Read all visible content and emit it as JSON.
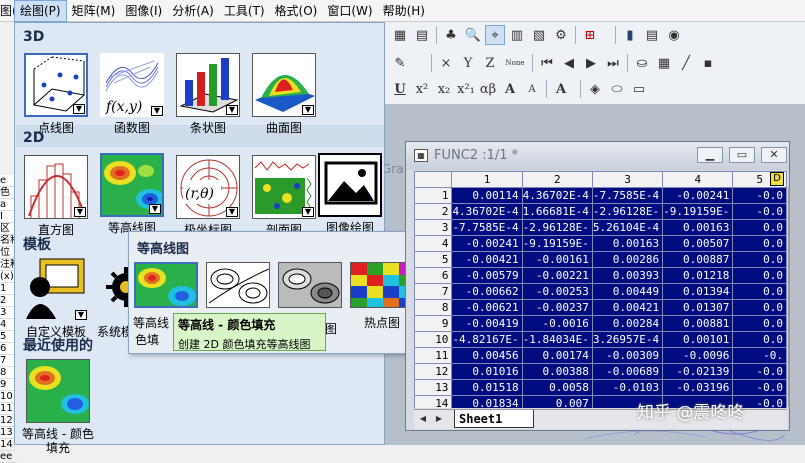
{
  "menubar": {
    "items": [
      "图(A)",
      "绘图(P)",
      "矩阵(M)",
      "图像(I)",
      "分析(A)",
      "工具(T)",
      "格式(O)",
      "窗口(W)",
      "帮助(H)"
    ]
  },
  "dropdown": {
    "section_3d": "3D",
    "section_2d": "2D",
    "section_templates": "模板",
    "section_recent": "最近使用的",
    "tiles_3d": [
      "点线图",
      "函数图",
      "条状图",
      "曲面图"
    ],
    "tiles_2d": [
      "直方图",
      "等高线图",
      "极坐标图",
      "剖面图",
      "图像绘图"
    ],
    "tiles_templates": [
      "自定义模板",
      "系统模"
    ],
    "recent_label": "等高线 - 颜色填充",
    "func_glyph": "f(x,y)",
    "polar_glyph": "(r,θ)"
  },
  "submenu": {
    "title": "等高线图",
    "items": [
      "等高线 - 颜色填充",
      "",
      "",
      "热点图"
    ],
    "partial_label_1": "等高线",
    "partial_label_2": "色填",
    "partial_label_3": "图"
  },
  "tooltip": {
    "title": "等高线 - 颜色填充",
    "desc": "创建 2D 颜色填充等高线图"
  },
  "left_strip": [
    "e",
    "色",
    "a",
    "I",
    "区",
    "名称",
    "位",
    "注释",
    "(x)=",
    "1",
    "2",
    "3",
    "4",
    "5",
    "6",
    "7",
    "8",
    "9",
    "10",
    "11",
    "12",
    "13",
    "14",
    "ee"
  ],
  "toolbar": {
    "row2_items": [
      "×",
      "Y",
      "Z",
      "None"
    ],
    "row3_items": [
      "U",
      "x²",
      "x₂",
      "x²₁",
      "αβ",
      "A",
      "A"
    ]
  },
  "workbook": {
    "title": "FUNC2 :1/1  *",
    "behind_text": "Gra",
    "columns": [
      "1",
      "2",
      "3",
      "4",
      "5"
    ],
    "rows": [
      [
        "1",
        "0.00114",
        "4.36702E-4",
        "-7.7585E-4",
        "-0.00241",
        "-0.0"
      ],
      [
        "2",
        "4.36702E-4",
        "1.66681E-4",
        "-2.96128E-",
        "-9.19159E-",
        "-0.0"
      ],
      [
        "3",
        "-7.7585E-4",
        "-2.96128E-",
        "5.26104E-4",
        "0.00163",
        "0.0"
      ],
      [
        "4",
        "-0.00241",
        "-9.19159E-",
        "0.00163",
        "0.00507",
        "0.0"
      ],
      [
        "5",
        "-0.00421",
        "-0.00161",
        "0.00286",
        "0.00887",
        "0.0"
      ],
      [
        "6",
        "-0.00579",
        "-0.00221",
        "0.00393",
        "0.01218",
        "0.0"
      ],
      [
        "7",
        "-0.00662",
        "-0.00253",
        "0.00449",
        "0.01394",
        "0.0"
      ],
      [
        "8",
        "-0.00621",
        "-0.00237",
        "0.00421",
        "0.01307",
        "0.0"
      ],
      [
        "9",
        "-0.00419",
        "-0.0016",
        "0.00284",
        "0.00881",
        "0.0"
      ],
      [
        "10",
        "-4.82167E-",
        "-1.84034E-",
        "3.26957E-4",
        "0.00101",
        "0.0"
      ],
      [
        "11",
        "0.00456",
        "0.00174",
        "-0.00309",
        "-0.0096",
        "-0."
      ],
      [
        "12",
        "0.01016",
        "0.00388",
        "-0.00689",
        "-0.02139",
        "-0.0"
      ],
      [
        "13",
        "0.01518",
        "0.0058",
        "-0.0103",
        "-0.03196",
        "-0.0"
      ],
      [
        "14",
        "0.01834",
        "0.007",
        "",
        "",
        "-0.0"
      ]
    ],
    "sheet_tab": "Sheet1"
  },
  "watermark": "知乎 @震咚咚",
  "colors": {
    "grid_bg": "#000c80",
    "menu_bg": "#dde8f4",
    "tooltip_bg": "#d8f5c8"
  }
}
